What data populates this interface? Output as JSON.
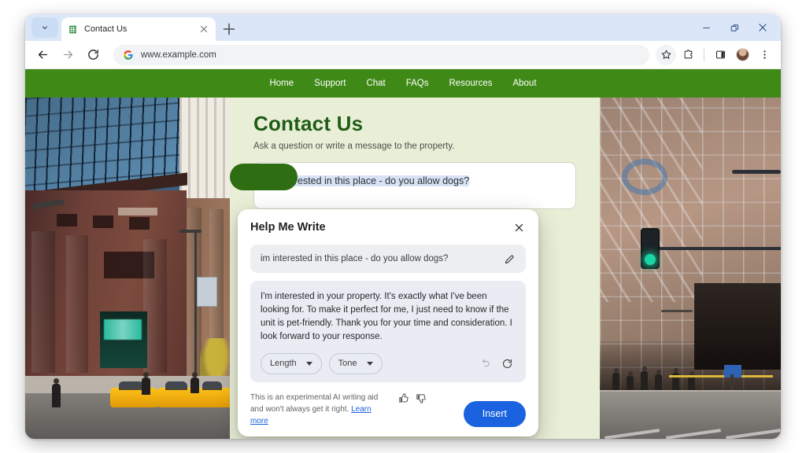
{
  "browser": {
    "tab": {
      "title": "Contact Us",
      "favicon": "spreadsheet-icon"
    },
    "tab_search_icon": "chevron-down-icon",
    "new_tab_icon": "plus-icon",
    "tab_close_icon": "close-icon",
    "window_controls": {
      "minimize": "minimize-icon",
      "restore": "restore-icon",
      "close": "close-icon"
    },
    "nav": {
      "back_icon": "arrow-left-icon",
      "forward_icon": "arrow-right-icon",
      "reload_icon": "reload-icon"
    },
    "omnibox": {
      "url": "www.example.com",
      "search_engine_icon": "google-g-icon"
    },
    "toolbar_icons": [
      "bookmark-star-icon",
      "extensions-icon",
      "side-panel-icon",
      "profile-avatar",
      "more-menu-icon"
    ]
  },
  "site": {
    "nav_items": [
      {
        "label": "Home"
      },
      {
        "label": "Support"
      },
      {
        "label": "Chat"
      },
      {
        "label": "FAQs"
      },
      {
        "label": "Resources"
      },
      {
        "label": "About"
      }
    ],
    "heading": "Contact Us",
    "subheading": "Ask a question or write a message to the property.",
    "message_value": "im interested in this place - do you allow dogs?",
    "nav_bg": "#3f8a17",
    "page_bg": "#e9efd7",
    "heading_color": "#1f5c17"
  },
  "dialog": {
    "title": "Help Me Write",
    "close_icon": "close-icon",
    "prompt": {
      "text": "im interested in this place - do you allow dogs?",
      "edit_icon": "pencil-icon"
    },
    "generated_text": "I'm interested in your property. It's exactly what I've been looking for. To make it perfect for me, I just need to know if the unit is pet-friendly. Thank you for your time and consideration. I look forward to your response.",
    "controls": [
      {
        "label": "Length",
        "icon": "chevron-down-icon"
      },
      {
        "label": "Tone",
        "icon": "chevron-down-icon"
      }
    ],
    "undo_icon": "undo-icon",
    "refresh_icon": "refresh-icon",
    "disclaimer_part1": "This is an experimental AI writing aid and won't always get it right. ",
    "disclaimer_link": "Learn more",
    "feedback_icons": [
      "thumbs-up-icon",
      "thumbs-down-icon"
    ],
    "insert_label": "Insert",
    "insert_color": "#1a62e0"
  },
  "photos": {
    "left_alt": "city-street-building-taxis-photo",
    "right_alt": "city-street-traffic-light-photo"
  }
}
